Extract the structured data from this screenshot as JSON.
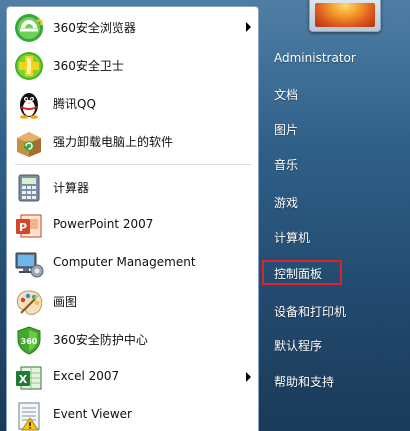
{
  "left_items": [
    {
      "label": "360安全浏览器",
      "icon": "360-browser-icon",
      "has_arrow": true
    },
    {
      "label": "360安全卫士",
      "icon": "360-security-icon",
      "has_arrow": false
    },
    {
      "label": "腾讯QQ",
      "icon": "qq-penguin-icon",
      "has_arrow": false
    },
    {
      "label": "强力卸载电脑上的软件",
      "icon": "uninstaller-box-icon",
      "has_arrow": false
    },
    {
      "label": "计算器",
      "icon": "calculator-icon",
      "has_arrow": false
    },
    {
      "label": "PowerPoint 2007",
      "icon": "powerpoint-icon",
      "has_arrow": false
    },
    {
      "label": "Computer Management",
      "icon": "computer-management-icon",
      "has_arrow": false
    },
    {
      "label": "画图",
      "icon": "paint-palette-icon",
      "has_arrow": false
    },
    {
      "label": "360安全防护中心",
      "icon": "360-shield-icon",
      "has_arrow": false
    },
    {
      "label": "Excel 2007",
      "icon": "excel-icon",
      "has_arrow": true
    },
    {
      "label": "Event Viewer",
      "icon": "event-viewer-icon",
      "has_arrow": false
    }
  ],
  "right_items": [
    {
      "label": "Administrator"
    },
    {
      "label": "文档"
    },
    {
      "label": "图片"
    },
    {
      "label": "音乐"
    },
    {
      "label": "游戏"
    },
    {
      "label": "计算机"
    },
    {
      "label": "控制面板",
      "highlighted": true
    },
    {
      "label": "设备和打印机"
    },
    {
      "label": "默认程序"
    },
    {
      "label": "帮助和支持"
    }
  ],
  "colors": {
    "highlight_border": "#d9262c",
    "right_text": "#ffffff",
    "left_text": "#101010"
  }
}
